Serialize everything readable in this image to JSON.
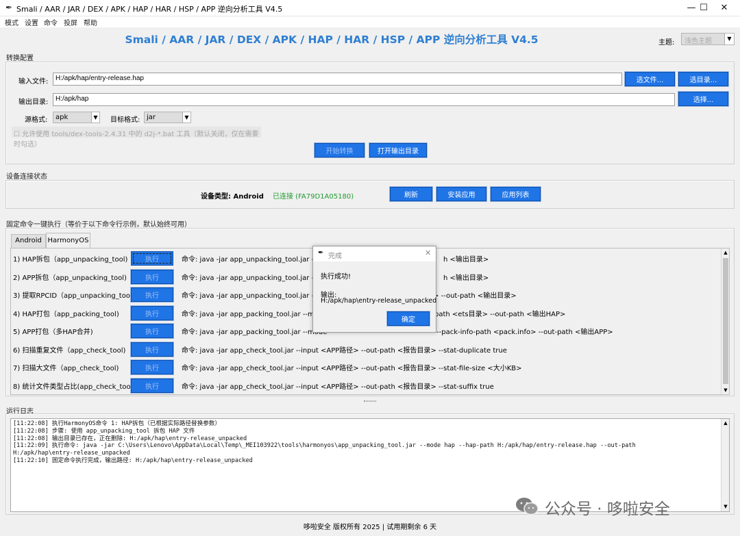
{
  "window": {
    "title": "Smali / AAR / JAR / DEX / APK / HAP / HAR / HSP / APP 逆向分析工具 V4.5"
  },
  "menu": [
    "模式",
    "设置",
    "命令",
    "投屏",
    "帮助"
  ],
  "header": {
    "headline": "Smali / AAR / JAR / DEX / APK / HAP / HAR / HSP / APP 逆向分析工具 V4.5",
    "theme_label": "主题:",
    "theme_value": "浅色主题"
  },
  "convert": {
    "section_label": "转换配置",
    "input_label": "输入文件:",
    "input_value": "H:/apk/hap/entry-release.hap",
    "select_file_btn": "选文件...",
    "select_dir_btn": "选目录...",
    "output_label": "输出目录:",
    "output_value": "H:/apk/hap",
    "choose_btn": "选择...",
    "src_format_label": "源格式:",
    "src_format_value": "apk",
    "dst_format_label": "目标格式:",
    "dst_format_value": "jar",
    "d2j_option": "允许使用 tools/dex-tools-2.4.31 中的 d2j-*.bat 工具（默认关闭，仅在需要时勾选）",
    "start_btn": "开始转换",
    "open_output_btn": "打开输出目录"
  },
  "device": {
    "section_label": "设备连接状态",
    "type_label": "设备类型: Android",
    "status_text": "已连接 (FA79D1A05180)",
    "status_color": "#1e9a2e",
    "refresh_btn": "刷新",
    "install_btn": "安装应用",
    "apps_btn": "应用列表"
  },
  "commands": {
    "section_label": "固定命令一键执行（等价于以下命令行示例，默认始终可用）",
    "tabs": [
      "Android",
      "HarmonyOS"
    ],
    "active_tab": "HarmonyOS",
    "exec_label": "执行",
    "rows": [
      {
        "label": "1) HAP拆包（app_unpacking_tool)",
        "cmd_left": "命令: java -jar app_unpacking_tool.jar --mo",
        "cmd_right": "h <输出目录>"
      },
      {
        "label": "2) APP拆包（app_unpacking_tool)",
        "cmd_left": "命令: java -jar app_unpacking_tool.jar --mo",
        "cmd_right": "h <输出目录>"
      },
      {
        "label": "3) 提取RPCID（app_unpacking_tool)",
        "cmd_left": "命令: java -jar app_unpacking_tool.jar --mo",
        "cmd_right": "> --out-path <输出目录>"
      },
      {
        "label": "4) HAP打包（app_packing_tool)",
        "cmd_left": "命令: java -jar app_packing_tool.jar --mode",
        "cmd_right": "path <ets目录> --out-path <输出HAP>"
      },
      {
        "label": "5) APP打包（多HAP合并)",
        "cmd_left": "命令: java -jar app_packing_tool.jar --mode",
        "cmd_right": "--pack-info-path <pack.info> --out-path <输出APP>"
      },
      {
        "label": "6) 扫描重复文件（app_check_tool)",
        "cmd_left": "命令: java -jar app_check_tool.jar --input <APP路径> --out-path <报告目录> --stat-duplicate true",
        "cmd_right": ""
      },
      {
        "label": "7) 扫描大文件（app_check_tool)",
        "cmd_left": "命令: java -jar app_check_tool.jar --input <APP路径> --out-path <报告目录> --stat-file-size <大小KB>",
        "cmd_right": ""
      },
      {
        "label": "8) 统计文件类型占比(app_check_tool)",
        "cmd_left": "命令: java -jar app_check_tool.jar --input <APP路径> --out-path <报告目录> --stat-suffix true",
        "cmd_right": ""
      }
    ]
  },
  "dialog": {
    "title": "完成",
    "message": "执行成功!",
    "output_label": "输出:",
    "output_path": "H:/apk/hap\\entry-release_unpacked",
    "ok_btn": "确定"
  },
  "log": {
    "section_label": "运行日志",
    "lines": [
      "[11:22:08] 执行HarmonyOS命令 1: HAP拆包（已根据实际路径替换参数）",
      "[11:22:08] 步骤: 使用 app_unpacking_tool 拆包 HAP 文件",
      "[11:22:08] 输出目录已存在，正在删除: H:/apk/hap\\entry-release_unpacked",
      "[11:22:09] 执行命令: java -jar C:\\Users\\Lenovo\\AppData\\Local\\Temp\\_MEI103922\\tools\\harmonyos\\app_unpacking_tool.jar --mode hap --hap-path H:/apk/hap/entry-release.hap --out-path",
      "H:/apk/hap\\entry-release_unpacked",
      "[11:22:10] 固定命令执行完成，输出路径: H:/apk/hap\\entry-release_unpacked"
    ]
  },
  "footer": {
    "text": "哆啦安全 版权所有 2025 | 试用期剩余 6 天"
  },
  "watermark": {
    "text": "公众号 · 哆啦安全"
  }
}
